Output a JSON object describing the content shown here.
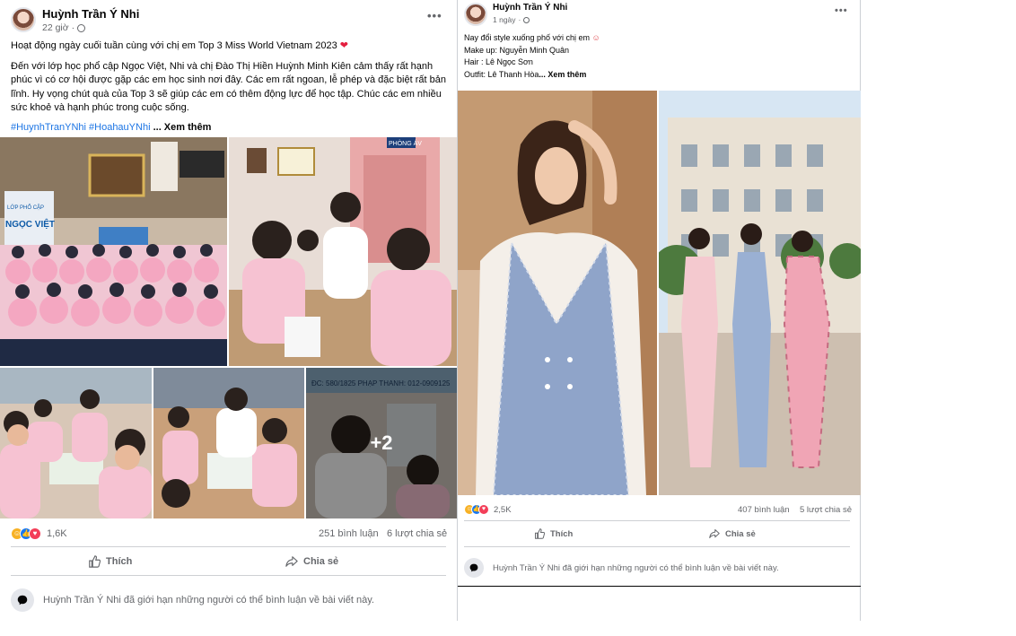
{
  "post1": {
    "author": "Huỳnh Trần Ý Nhi",
    "time": "22 giờ",
    "title_line": "Hoạt động ngày cuối tuần cùng với chị em Top 3 Miss World Vietnam 2023",
    "body": "Đến với lớp học phổ cập Ngọc Việt, Nhi và chị Đào Thị Hiền Huỳnh Minh Kiên cảm thấy rất hạnh phúc vì có cơ hội được gặp các em học sinh nơi đây. Các em rất ngoan, lễ phép và đặc biệt rất bản lĩnh. Hy vọng chút quà của Top 3 sẽ giúp các em có thêm động lực để học tập. Chúc các em nhiều sức khoẻ và hạnh phúc trong cuộc sống.",
    "hashtags": "#HuynhTranYNhi #HoahauYNhi",
    "see_more": "... Xem thêm",
    "more_photos": "+2",
    "photo_signs": {
      "banner1": "NGỌC VIỆT",
      "banner2": "LỚP PHỔ CẬP",
      "door": "PHÒNG ÁV",
      "wall": "ĐC: 580/1825 PHẠP THANH: 012-0909125"
    },
    "reaction_count": "1,6K",
    "comments": "251 bình luận",
    "shares": "6 lượt chia sẻ",
    "like_label": "Thích",
    "share_label": "Chia sẻ",
    "notice": "Huỳnh Trần Ý Nhi đã giới hạn những người có thể bình luận về bài viết này."
  },
  "post2": {
    "author": "Huỳnh Trần Ý Nhi",
    "time": "1 ngày",
    "caption": "Nay đổi style xuống phố với chị em",
    "makeup": "Make up: Nguyễn Minh Quân",
    "hair": "Hair : Lê Ngọc Sơn",
    "outfit": "Outfit: Lê Thanh Hòa",
    "see_more": "... Xem thêm",
    "reaction_count": "2,5K",
    "comments": "407 bình luận",
    "shares": "5 lượt chia sẻ",
    "like_label": "Thích",
    "share_label": "Chia sẻ",
    "notice": "Huỳnh Trần Ý Nhi đã giới hạn những người có thể bình luận về bài viết này."
  },
  "icons": {
    "more": "more-options-icon",
    "globe": "globe-icon",
    "heart": "heart-emoji",
    "hug": "smiling-hearts-emoji",
    "like": "thumbs-up-icon",
    "share": "share-arrow-icon",
    "comment": "comment-bubble-icon"
  },
  "colors": {
    "link": "#1b74e4",
    "secondary_text": "#65676b",
    "like_blue": "#1877f2",
    "love_red": "#f33e58",
    "care_yellow": "#f7b125"
  }
}
